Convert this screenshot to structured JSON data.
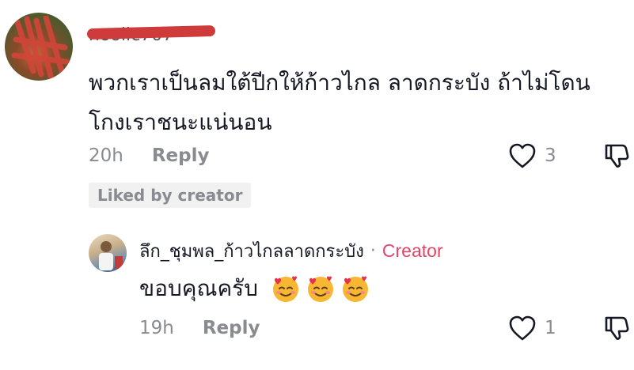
{
  "comment": {
    "username": "noolic707",
    "text": "พวกเราเป็นลมใต้ปีกให้ก้าวไกล ลาดกระบัง ถ้าไม่โดน\nโกงเราชนะแน่นอน",
    "time": "20h",
    "reply_label": "Reply",
    "like_count": "3",
    "liked_badge": "Liked by creator"
  },
  "reply": {
    "username": "ลึก_ชุมพล_ก้าวไกลลาดกระบัง",
    "separator": "·",
    "creator_label": "Creator",
    "text": "ขอบคุณครับ",
    "emoji_count": 3,
    "time": "19h",
    "reply_label": "Reply",
    "like_count": "1"
  },
  "colors": {
    "text_primary": "#161823",
    "text_secondary": "#8a8b91",
    "creator_accent": "#e14668",
    "badge_bg": "#f1f1f2",
    "redaction": "#cf3b3b"
  },
  "icons": {
    "like": "heart-outline-icon",
    "dislike": "thumbs-down-outline-icon",
    "emoji": "smiling-face-with-hearts-icon"
  }
}
